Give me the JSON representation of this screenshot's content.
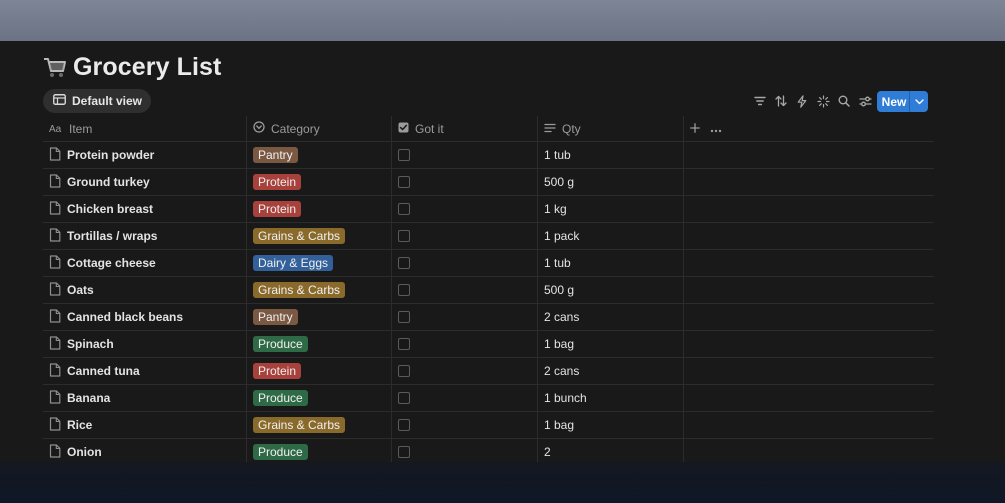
{
  "page": {
    "title": "Grocery List",
    "icon": "shopping-cart-icon"
  },
  "view": {
    "label": "Default view",
    "icon": "table-view-icon"
  },
  "toolbar": {
    "icons": [
      "filter-icon",
      "sort-icon",
      "automation-icon",
      "ai-sparkle-icon",
      "search-icon",
      "settings-sliders-icon"
    ],
    "new_label": "New"
  },
  "columns": [
    {
      "label": "Item",
      "icon": "text-property-icon"
    },
    {
      "label": "Category",
      "icon": "select-property-icon"
    },
    {
      "label": "Got it",
      "icon": "checkbox-property-icon"
    },
    {
      "label": "Qty",
      "icon": "text-lines-property-icon"
    }
  ],
  "tag_colors": {
    "Pantry": "#7a5842",
    "Protein": "#a8413b",
    "Grains & Carbs": "#8a6a2a",
    "Dairy & Eggs": "#32609a",
    "Produce": "#2f6a47"
  },
  "rows": [
    {
      "item": "Protein powder",
      "category": "Pantry",
      "got": false,
      "qty": "1 tub"
    },
    {
      "item": "Ground turkey",
      "category": "Protein",
      "got": false,
      "qty": "500 g"
    },
    {
      "item": "Chicken breast",
      "category": "Protein",
      "got": false,
      "qty": "1 kg"
    },
    {
      "item": "Tortillas / wraps",
      "category": "Grains & Carbs",
      "got": false,
      "qty": "1 pack"
    },
    {
      "item": "Cottage cheese",
      "category": "Dairy & Eggs",
      "got": false,
      "qty": "1 tub"
    },
    {
      "item": "Oats",
      "category": "Grains & Carbs",
      "got": false,
      "qty": "500 g"
    },
    {
      "item": "Canned black beans",
      "category": "Pantry",
      "got": false,
      "qty": "2 cans"
    },
    {
      "item": "Spinach",
      "category": "Produce",
      "got": false,
      "qty": "1 bag"
    },
    {
      "item": "Canned tuna",
      "category": "Protein",
      "got": false,
      "qty": "2 cans"
    },
    {
      "item": "Banana",
      "category": "Produce",
      "got": false,
      "qty": "1 bunch"
    },
    {
      "item": "Rice",
      "category": "Grains & Carbs",
      "got": false,
      "qty": "1 bag"
    },
    {
      "item": "Onion",
      "category": "Produce",
      "got": false,
      "qty": "2"
    }
  ]
}
